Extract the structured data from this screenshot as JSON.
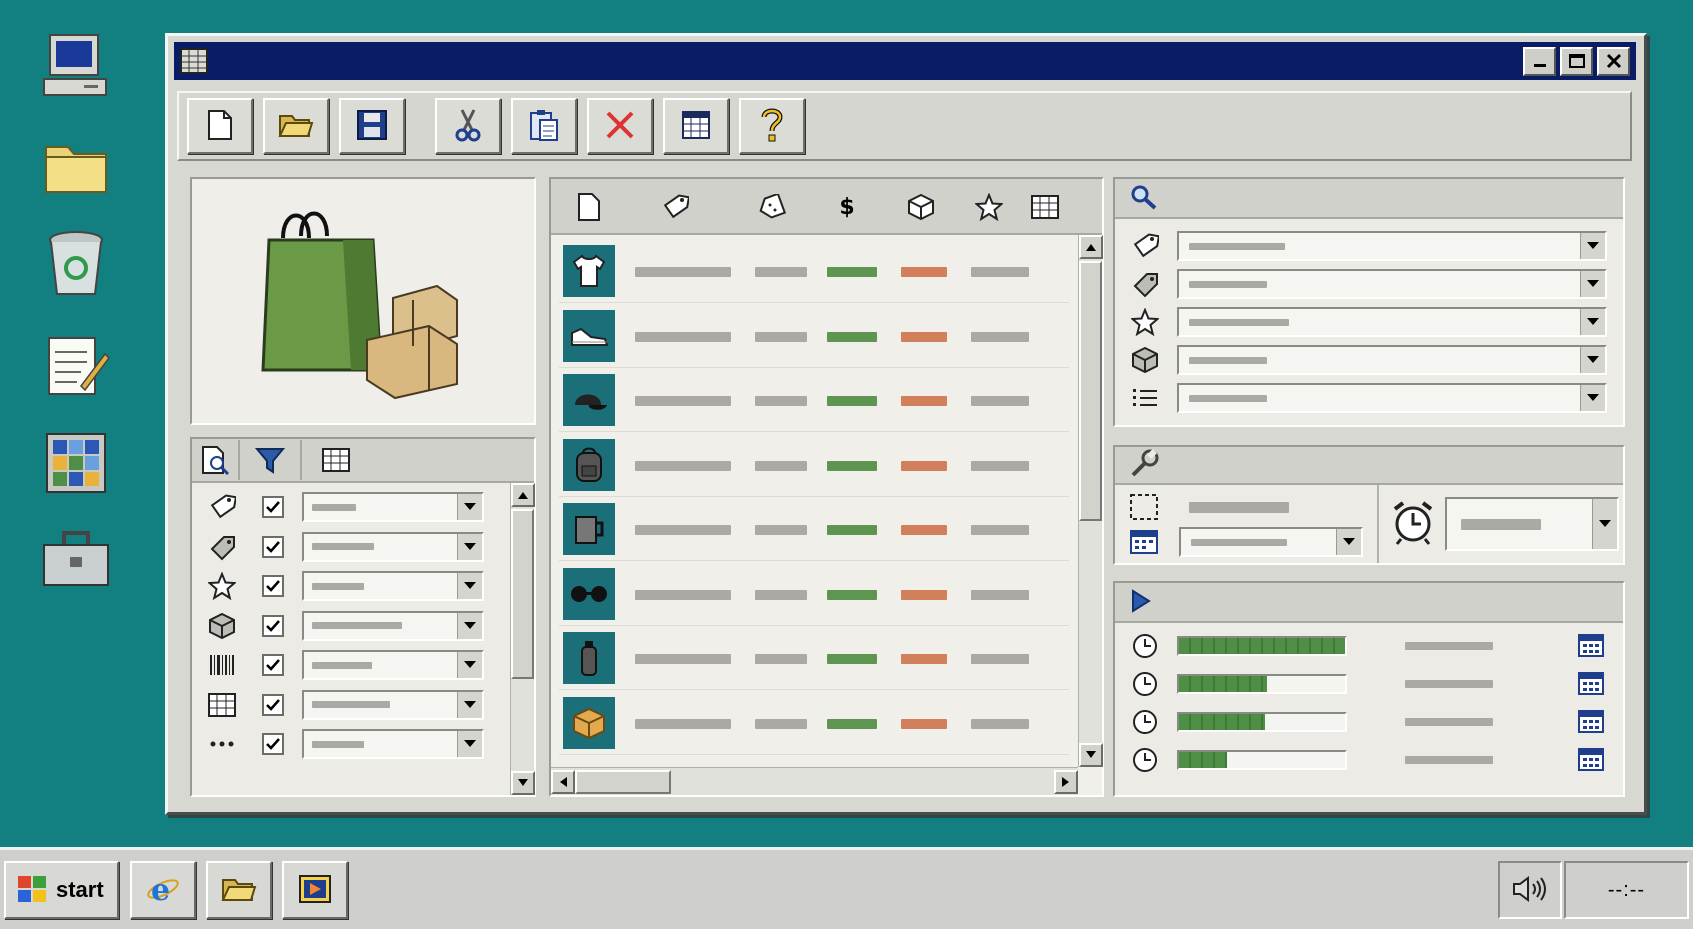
{
  "desktop": {
    "icons": [
      "my-computer-icon",
      "folder-icon",
      "recycle-bin-icon",
      "notepad-icon",
      "spreadsheet-app-icon",
      "toolbox-icon"
    ]
  },
  "window": {
    "title_icon": "spreadsheet-icon",
    "controls": [
      "minimize",
      "maximize",
      "close"
    ]
  },
  "toolbar": {
    "buttons": [
      "new-file",
      "open-folder",
      "save",
      "cut",
      "paste",
      "delete",
      "table",
      "help"
    ]
  },
  "filters": {
    "header_tabs": [
      "search-document-icon",
      "funnel-icon",
      "table-icon"
    ],
    "rows": [
      {
        "icon": "tag-icon",
        "checked": true
      },
      {
        "icon": "tags-icon",
        "checked": true
      },
      {
        "icon": "star-icon",
        "checked": true
      },
      {
        "icon": "box-icon",
        "checked": true
      },
      {
        "icon": "barcode-icon",
        "checked": true
      },
      {
        "icon": "table-icon",
        "checked": true
      },
      {
        "icon": "more-icon",
        "checked": true
      }
    ]
  },
  "products": {
    "columns": [
      "document-icon",
      "tag-icon",
      "discount-tag-icon",
      "$",
      "box-icon",
      "star-icon",
      "table-icon"
    ],
    "price_symbol": "$",
    "rows": [
      "t-shirt",
      "sneaker",
      "cap",
      "backpack",
      "mug",
      "sunglasses",
      "bottle",
      "box"
    ]
  },
  "search": {
    "header_icon": "magnifier-icon",
    "fields": [
      "tag-icon",
      "tags-icon",
      "star-icon",
      "box-icon",
      "list-icon"
    ]
  },
  "settings": {
    "header_icon": "wrench-icon"
  },
  "progress": {
    "header_icon": "play-icon",
    "rows": [
      {
        "fraction": 1.0
      },
      {
        "fraction": 0.53
      },
      {
        "fraction": 0.52
      },
      {
        "fraction": 0.29
      }
    ]
  },
  "taskbar": {
    "start_label": "start",
    "clock_placeholder": "--:--"
  },
  "colors": {
    "desktop": "#127f80",
    "titlebar": "#0b1c66",
    "accent_green": "#5e9550",
    "accent_orange": "#d27f5b"
  }
}
